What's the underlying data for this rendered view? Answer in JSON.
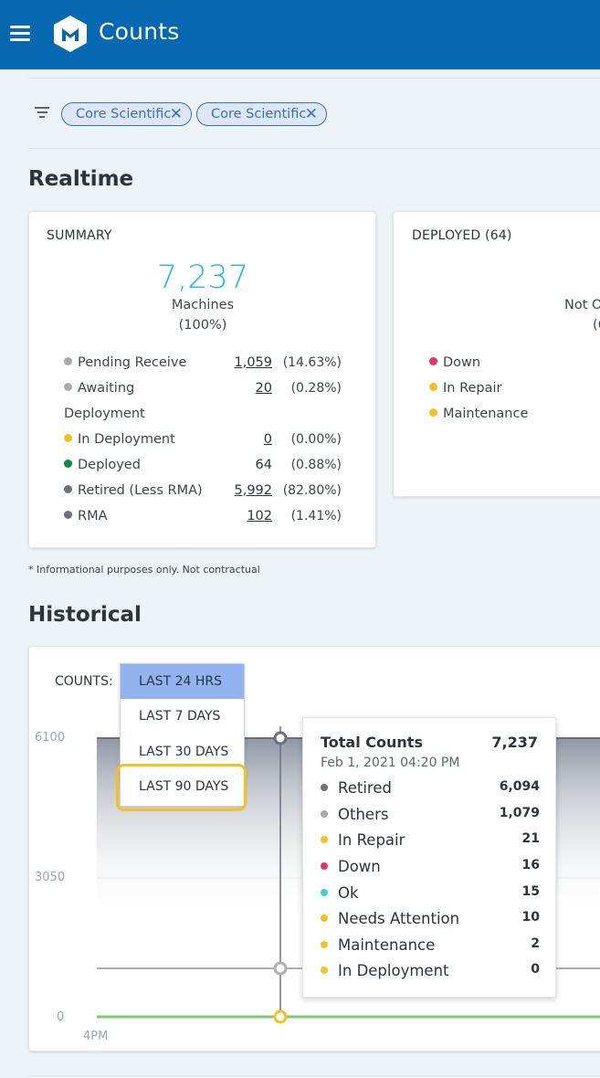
{
  "colors": {
    "header_bg": "#0668b0",
    "accent": "#2ab4ea",
    "chip": "#3a6fc4",
    "highlight": "#f5c023",
    "status": {
      "grey": "#a9a9a9",
      "yellow": "#f5c023",
      "green": "#0f8a3c",
      "dark": "#6a7080",
      "red": "#e8336a",
      "teal": "#3fd1cf"
    }
  },
  "header": {
    "title": "Counts",
    "menu_icon": "hamburger-menu-icon",
    "logo_icon": "cube-logo-icon"
  },
  "filters": {
    "icon": "filter-icon",
    "chips": [
      {
        "label": "Core Scientific"
      },
      {
        "label": "Core Scientific"
      }
    ]
  },
  "realtime": {
    "title": "Realtime",
    "summary": {
      "title": "SUMMARY",
      "total": "7,237",
      "total_label": "Machines",
      "total_pct": "(100%)",
      "rows": [
        {
          "label": "Pending Receive",
          "value": "1,059",
          "pct": "(14.63%)",
          "color": "#a9a9a9"
        },
        {
          "label": "Awaiting",
          "label2": "Deployment",
          "value": "20",
          "pct": "(0.28%)",
          "color": "#a9a9a9"
        },
        {
          "label": "In Deployment",
          "value": "0",
          "pct": "(0.00%)",
          "color": "#f5c023"
        },
        {
          "label": "Deployed",
          "value": "64",
          "pct": "(0.88%)",
          "color": "#0f8a3c"
        },
        {
          "label": "Retired (Less RMA)",
          "value": "5,992",
          "pct": "(82.80%)",
          "color": "#6a7080"
        },
        {
          "label": "RMA",
          "value": "102",
          "pct": "(1.41%)",
          "color": "#6a7080"
        }
      ]
    },
    "deployed": {
      "title": "DEPLOYED (64)",
      "partial_line1": "Not O",
      "partial_line2": "(6",
      "rows": [
        {
          "label": "Down",
          "color": "#e8336a"
        },
        {
          "label": "In Repair",
          "color": "#f5c023"
        },
        {
          "label": "Maintenance",
          "color": "#f5c023"
        }
      ]
    },
    "footnote": "* Informational purposes only. Not contractual"
  },
  "historical": {
    "title": "Historical",
    "counts_label": "COUNTS:",
    "range_options": [
      "LAST 24 HRS",
      "LAST 7 DAYS",
      "LAST 30 DAYS",
      "LAST 90 DAYS"
    ],
    "selected_range": "LAST 24 HRS",
    "y_ticks": [
      "6100",
      "3050",
      "0"
    ],
    "x_tick": "4PM",
    "tooltip": {
      "title": "Total Counts",
      "total": "7,237",
      "date": "Feb 1, 2021 04:20 PM",
      "rows": [
        {
          "label": "Retired",
          "value": "6,094",
          "color": "#6a7080"
        },
        {
          "label": "Others",
          "value": "1,079",
          "color": "#a9a9a9"
        },
        {
          "label": "In Repair",
          "value": "21",
          "color": "#f5c023"
        },
        {
          "label": "Down",
          "value": "16",
          "color": "#e8336a"
        },
        {
          "label": "Ok",
          "value": "15",
          "color": "#3fd1cf"
        },
        {
          "label": "Needs Attention",
          "value": "10",
          "color": "#f5c023"
        },
        {
          "label": "Maintenance",
          "value": "2",
          "color": "#f5c023"
        },
        {
          "label": "In Deployment",
          "value": "0",
          "color": "#f5c023"
        }
      ]
    }
  }
}
